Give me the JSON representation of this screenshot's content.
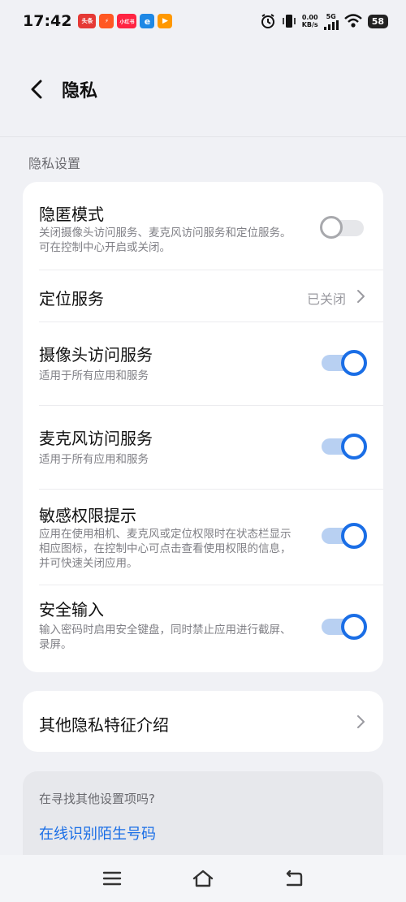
{
  "status_bar": {
    "time": "17:42",
    "apps": [
      {
        "label": "头条",
        "color": "#e53935",
        "icon": "toutiao-icon"
      },
      {
        "label": "⚡",
        "color": "#ff5722",
        "icon": "app-lightning-icon"
      },
      {
        "label": "小红书",
        "color": "#ff2442",
        "icon": "xiaohongshu-icon"
      },
      {
        "label": "e",
        "color": "#1e88e5",
        "icon": "browser-icon"
      },
      {
        "label": "▶",
        "color": "#ff9800",
        "icon": "video-icon"
      }
    ],
    "net_speed_value": "0.00",
    "net_speed_unit": "KB/s",
    "network_type": "5G",
    "battery": "58"
  },
  "header": {
    "title": "隐私"
  },
  "section": {
    "title": "隐私设置"
  },
  "privacy_items": [
    {
      "title": "隐匿模式",
      "desc": "关闭摄像头访问服务、麦克风访问服务和定位服务。可在控制中心开启或关闭。",
      "enabled": false
    },
    {
      "title": "定位服务",
      "value": "已关闭"
    },
    {
      "title": "摄像头访问服务",
      "desc": "适用于所有应用和服务",
      "enabled": true
    },
    {
      "title": "麦克风访问服务",
      "desc": "适用于所有应用和服务",
      "enabled": true
    },
    {
      "title": "敏感权限提示",
      "desc": "应用在使用相机、麦克风或定位权限时在状态栏显示相应图标，在控制中心可点击查看使用权限的信息，并可快速关闭应用。",
      "enabled": true
    },
    {
      "title": "安全输入",
      "desc": "输入密码时启用安全键盘，同时禁止应用进行截屏、录屏。",
      "enabled": true
    }
  ],
  "other": {
    "title": "其他隐私特征介绍"
  },
  "search_suggest": {
    "question": "在寻找其他设置项吗?",
    "link": "在线识别陌生号码"
  },
  "colors": {
    "accent": "#1a6ee6",
    "background": "#f0f1f5"
  }
}
